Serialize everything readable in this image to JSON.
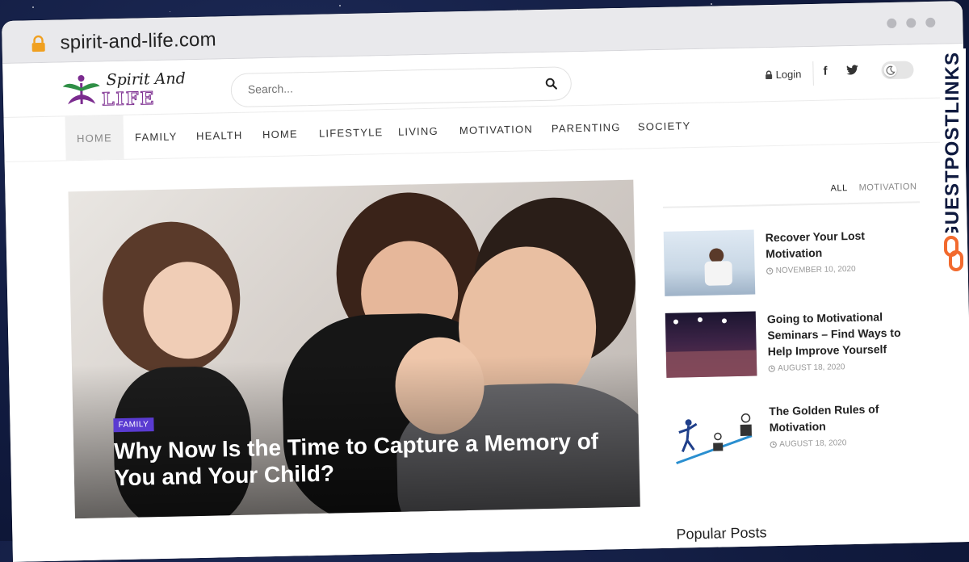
{
  "browser": {
    "url": "spirit-and-life.com"
  },
  "site": {
    "logo_top": "Spirit And",
    "logo_bottom": "LIFE",
    "search_placeholder": "Search...",
    "login_label": "Login",
    "facebook_glyph": "f"
  },
  "nav": {
    "items": [
      "HOME",
      "FAMILY",
      "HEALTH",
      "HOME",
      "LIFESTYLE",
      "LIVING",
      "MOTIVATION",
      "PARENTING",
      "SOCIETY"
    ]
  },
  "hero": {
    "category": "FAMILY",
    "title": "Why Now Is the Time to Capture a Memory of You and Your Child?"
  },
  "sidebar": {
    "filters": [
      "ALL",
      "MOTIVATION"
    ],
    "posts": [
      {
        "title": "Recover Your Lost Motivation",
        "date": "NOVEMBER 10, 2020"
      },
      {
        "title": "Going to Motivational Seminars – Find Ways to Help Improve Yourself",
        "date": "AUGUST 18, 2020"
      },
      {
        "title": "The Golden Rules of Motivation",
        "date": "AUGUST 18, 2020"
      }
    ],
    "popular_heading": "Popular Posts"
  },
  "watermark": {
    "text": "GUESTPOSTLINKS"
  },
  "colors": {
    "badge": "#5a3bd1",
    "logo_purple": "#7b2b8f",
    "lock": "#f0a020",
    "watermark_accent": "#f26a2e"
  }
}
